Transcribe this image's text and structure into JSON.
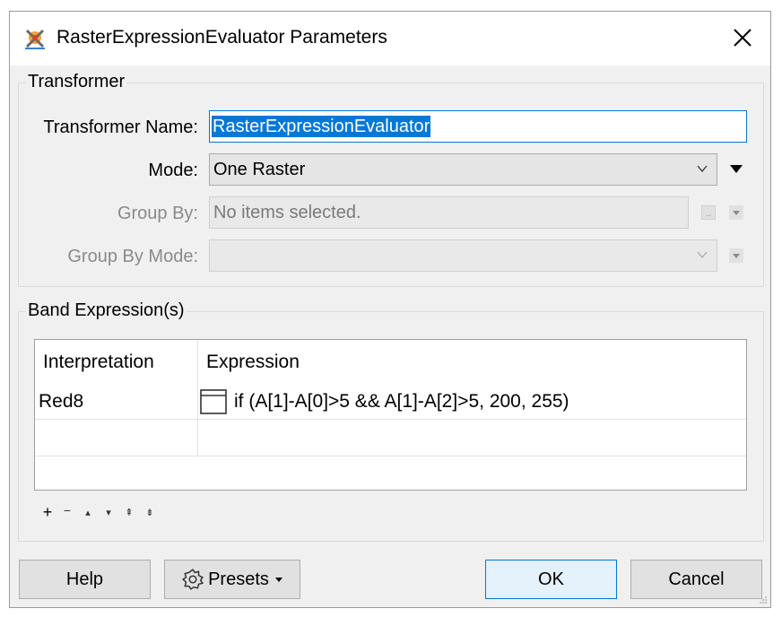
{
  "window": {
    "title": "RasterExpressionEvaluator Parameters"
  },
  "transformer": {
    "group_label": "Transformer",
    "name_label": "Transformer Name:",
    "name_value": "RasterExpressionEvaluator",
    "mode_label": "Mode:",
    "mode_value": "One Raster",
    "group_by_label": "Group By:",
    "group_by_value": "No items selected.",
    "group_by_mode_label": "Group By Mode:",
    "group_by_mode_value": ""
  },
  "band_expressions": {
    "group_label": "Band Expression(s)",
    "columns": [
      "Interpretation",
      "Expression"
    ],
    "rows": [
      {
        "interpretation": "Red8",
        "expression": "if (A[1]-A[0]>5 && A[1]-A[2]>5, 200, 255)"
      }
    ],
    "toolbar": [
      "+",
      "−",
      "▴",
      "▾",
      "⇞",
      "⇟"
    ]
  },
  "buttons": {
    "help": "Help",
    "presets": "Presets",
    "ok": "OK",
    "cancel": "Cancel"
  },
  "colors": {
    "accent": "#0078d7"
  }
}
